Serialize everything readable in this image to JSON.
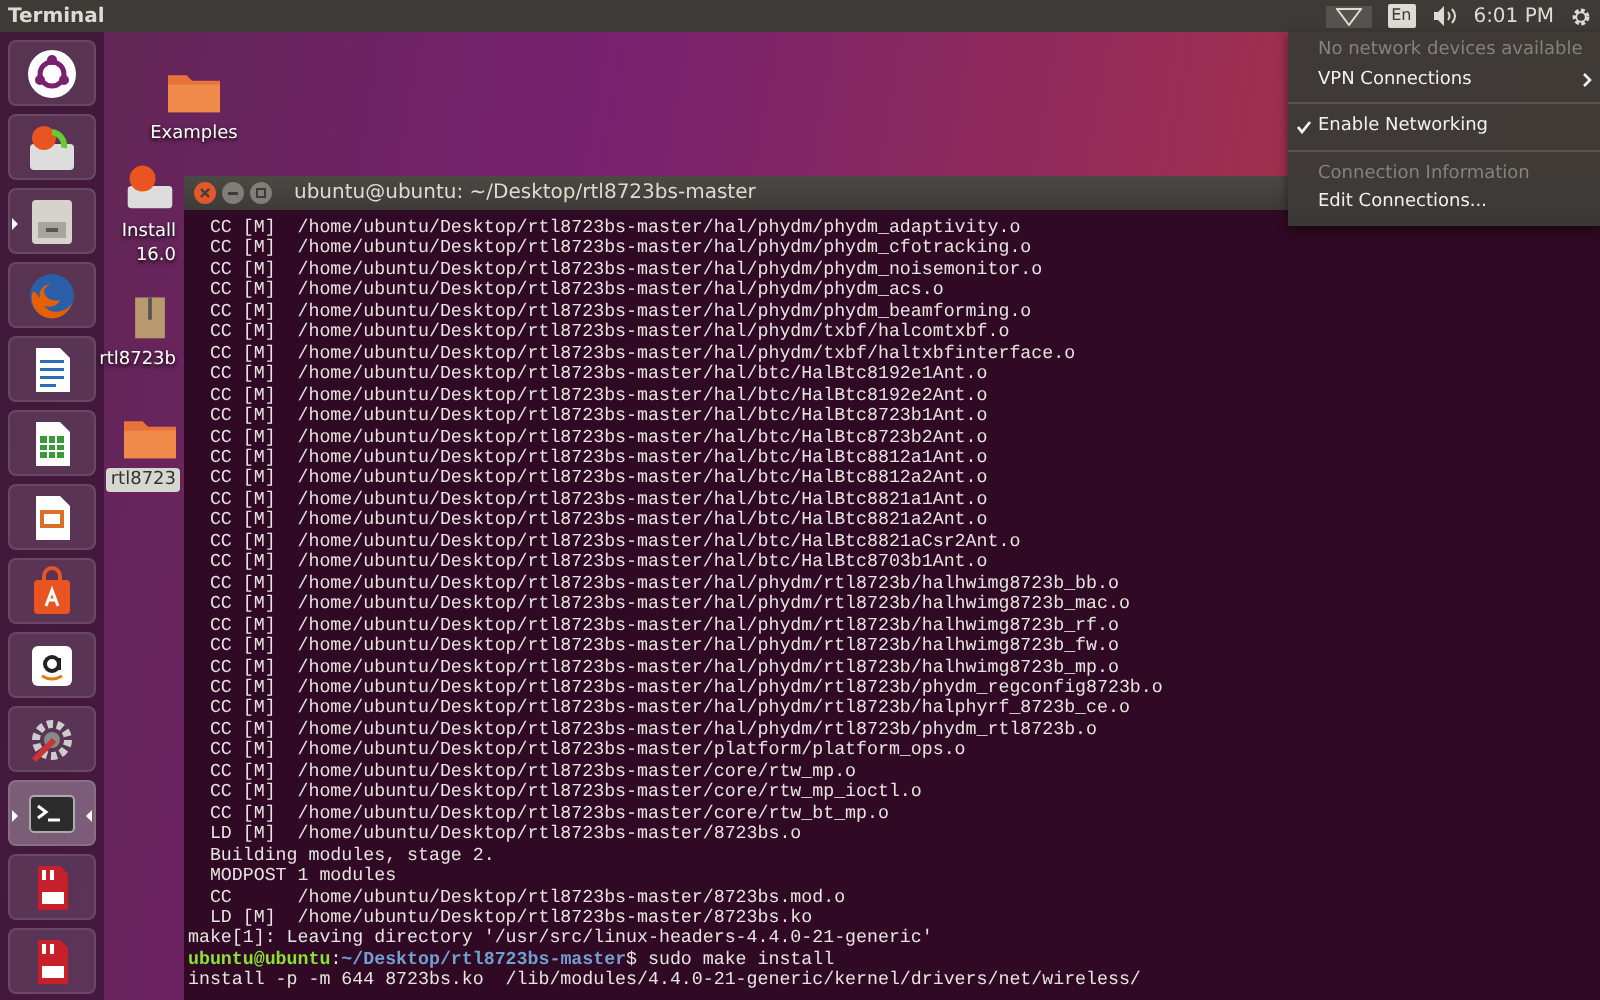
{
  "top_panel": {
    "app_title": "Terminal",
    "keyboard_layout": "En",
    "clock": "6:01 PM"
  },
  "launcher": [
    {
      "kind": "dash",
      "running": false,
      "focused": false
    },
    {
      "kind": "installer",
      "running": false,
      "focused": false
    },
    {
      "kind": "files",
      "running": true,
      "focused": false
    },
    {
      "kind": "firefox",
      "running": false,
      "focused": false
    },
    {
      "kind": "writer",
      "running": false,
      "focused": false
    },
    {
      "kind": "calc",
      "running": false,
      "focused": false
    },
    {
      "kind": "impress",
      "running": false,
      "focused": false
    },
    {
      "kind": "software",
      "running": false,
      "focused": false
    },
    {
      "kind": "amazon",
      "running": false,
      "focused": false
    },
    {
      "kind": "settings",
      "running": false,
      "focused": false
    },
    {
      "kind": "terminal",
      "running": true,
      "focused": true
    },
    {
      "kind": "sdcard",
      "running": false,
      "focused": false
    },
    {
      "kind": "sdcard",
      "running": false,
      "focused": false
    }
  ],
  "desktop_icons": [
    {
      "kind": "folder",
      "label": "Examples",
      "selected": false
    },
    {
      "kind": "installer",
      "label": "Install",
      "label_line2": "16.0",
      "selected": false
    },
    {
      "kind": "archive",
      "label": "rtl8723b",
      "selected": false
    },
    {
      "kind": "folder",
      "label": "rtl8723",
      "selected": true
    }
  ],
  "network_menu": [
    {
      "kind": "item",
      "label": "No network devices available",
      "disabled": true,
      "checked": false,
      "submenu": false
    },
    {
      "kind": "item",
      "label": "VPN Connections",
      "disabled": false,
      "checked": false,
      "submenu": true
    },
    {
      "kind": "separator"
    },
    {
      "kind": "item",
      "label": "Enable Networking",
      "disabled": false,
      "checked": true,
      "submenu": false
    },
    {
      "kind": "separator"
    },
    {
      "kind": "item",
      "label": "Connection Information",
      "disabled": true,
      "checked": false,
      "submenu": false
    },
    {
      "kind": "item",
      "label": "Edit Connections...",
      "disabled": false,
      "checked": false,
      "submenu": false
    }
  ],
  "terminal": {
    "title": "ubuntu@ubuntu: ~/Desktop/rtl8723bs-master",
    "lines": [
      {
        "kind": "output",
        "text": "  CC [M]  /home/ubuntu/Desktop/rtl8723bs-master/hal/phydm/phydm_adaptivity.o"
      },
      {
        "kind": "output",
        "text": "  CC [M]  /home/ubuntu/Desktop/rtl8723bs-master/hal/phydm/phydm_cfotracking.o"
      },
      {
        "kind": "output",
        "text": "  CC [M]  /home/ubuntu/Desktop/rtl8723bs-master/hal/phydm/phydm_noisemonitor.o"
      },
      {
        "kind": "output",
        "text": "  CC [M]  /home/ubuntu/Desktop/rtl8723bs-master/hal/phydm/phydm_acs.o"
      },
      {
        "kind": "output",
        "text": "  CC [M]  /home/ubuntu/Desktop/rtl8723bs-master/hal/phydm/phydm_beamforming.o"
      },
      {
        "kind": "output",
        "text": "  CC [M]  /home/ubuntu/Desktop/rtl8723bs-master/hal/phydm/txbf/halcomtxbf.o"
      },
      {
        "kind": "output",
        "text": "  CC [M]  /home/ubuntu/Desktop/rtl8723bs-master/hal/phydm/txbf/haltxbfinterface.o"
      },
      {
        "kind": "output",
        "text": "  CC [M]  /home/ubuntu/Desktop/rtl8723bs-master/hal/btc/HalBtc8192e1Ant.o"
      },
      {
        "kind": "output",
        "text": "  CC [M]  /home/ubuntu/Desktop/rtl8723bs-master/hal/btc/HalBtc8192e2Ant.o"
      },
      {
        "kind": "output",
        "text": "  CC [M]  /home/ubuntu/Desktop/rtl8723bs-master/hal/btc/HalBtc8723b1Ant.o"
      },
      {
        "kind": "output",
        "text": "  CC [M]  /home/ubuntu/Desktop/rtl8723bs-master/hal/btc/HalBtc8723b2Ant.o"
      },
      {
        "kind": "output",
        "text": "  CC [M]  /home/ubuntu/Desktop/rtl8723bs-master/hal/btc/HalBtc8812a1Ant.o"
      },
      {
        "kind": "output",
        "text": "  CC [M]  /home/ubuntu/Desktop/rtl8723bs-master/hal/btc/HalBtc8812a2Ant.o"
      },
      {
        "kind": "output",
        "text": "  CC [M]  /home/ubuntu/Desktop/rtl8723bs-master/hal/btc/HalBtc8821a1Ant.o"
      },
      {
        "kind": "output",
        "text": "  CC [M]  /home/ubuntu/Desktop/rtl8723bs-master/hal/btc/HalBtc8821a2Ant.o"
      },
      {
        "kind": "output",
        "text": "  CC [M]  /home/ubuntu/Desktop/rtl8723bs-master/hal/btc/HalBtc8821aCsr2Ant.o"
      },
      {
        "kind": "output",
        "text": "  CC [M]  /home/ubuntu/Desktop/rtl8723bs-master/hal/btc/HalBtc8703b1Ant.o"
      },
      {
        "kind": "output",
        "text": "  CC [M]  /home/ubuntu/Desktop/rtl8723bs-master/hal/phydm/rtl8723b/halhwimg8723b_bb.o"
      },
      {
        "kind": "output",
        "text": "  CC [M]  /home/ubuntu/Desktop/rtl8723bs-master/hal/phydm/rtl8723b/halhwimg8723b_mac.o"
      },
      {
        "kind": "output",
        "text": "  CC [M]  /home/ubuntu/Desktop/rtl8723bs-master/hal/phydm/rtl8723b/halhwimg8723b_rf.o"
      },
      {
        "kind": "output",
        "text": "  CC [M]  /home/ubuntu/Desktop/rtl8723bs-master/hal/phydm/rtl8723b/halhwimg8723b_fw.o"
      },
      {
        "kind": "output",
        "text": "  CC [M]  /home/ubuntu/Desktop/rtl8723bs-master/hal/phydm/rtl8723b/halhwimg8723b_mp.o"
      },
      {
        "kind": "output",
        "text": "  CC [M]  /home/ubuntu/Desktop/rtl8723bs-master/hal/phydm/rtl8723b/phydm_regconfig8723b.o"
      },
      {
        "kind": "output",
        "text": "  CC [M]  /home/ubuntu/Desktop/rtl8723bs-master/hal/phydm/rtl8723b/halphyrf_8723b_ce.o"
      },
      {
        "kind": "output",
        "text": "  CC [M]  /home/ubuntu/Desktop/rtl8723bs-master/hal/phydm/rtl8723b/phydm_rtl8723b.o"
      },
      {
        "kind": "output",
        "text": "  CC [M]  /home/ubuntu/Desktop/rtl8723bs-master/platform/platform_ops.o"
      },
      {
        "kind": "output",
        "text": "  CC [M]  /home/ubuntu/Desktop/rtl8723bs-master/core/rtw_mp.o"
      },
      {
        "kind": "output",
        "text": "  CC [M]  /home/ubuntu/Desktop/rtl8723bs-master/core/rtw_mp_ioctl.o"
      },
      {
        "kind": "output",
        "text": "  CC [M]  /home/ubuntu/Desktop/rtl8723bs-master/core/rtw_bt_mp.o"
      },
      {
        "kind": "output",
        "text": "  LD [M]  /home/ubuntu/Desktop/rtl8723bs-master/8723bs.o"
      },
      {
        "kind": "output",
        "text": "  Building modules, stage 2."
      },
      {
        "kind": "output",
        "text": "  MODPOST 1 modules"
      },
      {
        "kind": "output",
        "text": "  CC      /home/ubuntu/Desktop/rtl8723bs-master/8723bs.mod.o"
      },
      {
        "kind": "output",
        "text": "  LD [M]  /home/ubuntu/Desktop/rtl8723bs-master/8723bs.ko"
      },
      {
        "kind": "output",
        "text": "make[1]: Leaving directory '/usr/src/linux-headers-4.4.0-21-generic'"
      },
      {
        "kind": "prompt",
        "user": "ubuntu@ubuntu",
        "separator": ":",
        "path": "~/Desktop/rtl8723bs-master",
        "text": "$ sudo make install"
      },
      {
        "kind": "output",
        "text": "install -p -m 644 8723bs.ko  /lib/modules/4.4.0-21-generic/kernel/drivers/net/wireless/"
      }
    ]
  }
}
